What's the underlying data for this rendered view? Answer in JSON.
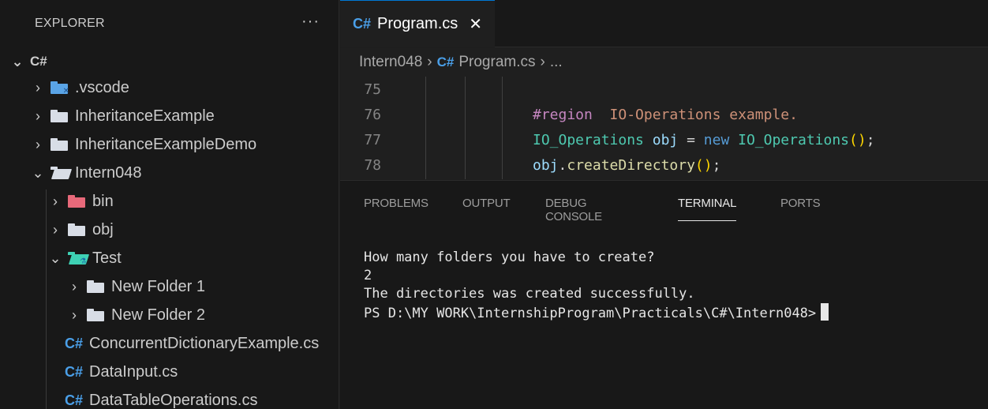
{
  "sidebar": {
    "title": "EXPLORER",
    "more_label": "···",
    "root_label": "C#",
    "items": [
      {
        "label": ".vscode",
        "chev": "›",
        "icon": "vscode-folder-icon"
      },
      {
        "label": "InheritanceExample",
        "chev": "›",
        "icon": "folder-icon"
      },
      {
        "label": "InheritanceExampleDemo",
        "chev": "›",
        "icon": "folder-icon"
      },
      {
        "label": "Intern048",
        "chev": "⌄",
        "icon": "open-folder-icon"
      },
      {
        "label": "bin",
        "chev": "›",
        "icon": "bin-folder-icon"
      },
      {
        "label": "obj",
        "chev": "›",
        "icon": "folder-icon"
      },
      {
        "label": "Test",
        "chev": "⌄",
        "icon": "test-folder-icon"
      },
      {
        "label": "New Folder 1",
        "chev": "›",
        "icon": "folder-icon"
      },
      {
        "label": "New Folder 2",
        "chev": "›",
        "icon": "folder-icon"
      },
      {
        "label": "ConcurrentDictionaryExample.cs",
        "icon": "csharp-file-icon"
      },
      {
        "label": "DataInput.cs",
        "icon": "csharp-file-icon"
      },
      {
        "label": "DataTableOperations.cs",
        "icon": "csharp-file-icon"
      }
    ]
  },
  "tabs": {
    "active_label": "Program.cs",
    "lang_badge": "C#",
    "close_glyph": "✕"
  },
  "breadcrumb": {
    "folder": "Intern048",
    "sep": "›",
    "lang_badge": "C#",
    "file": "Program.cs",
    "tail": "..."
  },
  "editor": {
    "lines": [
      {
        "number": "75"
      },
      {
        "number": "76",
        "region_kw": "#region",
        "region_name": "  IO-Operations example."
      },
      {
        "number": "77",
        "type": "IO_Operations",
        "var": "obj",
        "eq": " = ",
        "kw": "new",
        "ctor": "IO_Operations",
        "parens": "()",
        "semi": ";"
      },
      {
        "number": "78",
        "var": "obj",
        "dot": ".",
        "fn": "createDirectory",
        "parens": "()",
        "semi": ";"
      }
    ]
  },
  "panel": {
    "tabs": [
      "PROBLEMS",
      "OUTPUT",
      "DEBUG CONSOLE",
      "TERMINAL",
      "PORTS"
    ],
    "active_tab": "TERMINAL",
    "terminal_lines": [
      "How many folders you have to create?",
      "2",
      "The directories was created successfully.",
      "PS D:\\MY WORK\\InternshipProgram\\Practicals\\C#\\Intern048>"
    ]
  },
  "colors": {
    "accent": "#0078d4",
    "csharp_icon": "#4a9fe8",
    "bin_folder": "#e8697a",
    "test_folder": "#3ed1b4"
  }
}
